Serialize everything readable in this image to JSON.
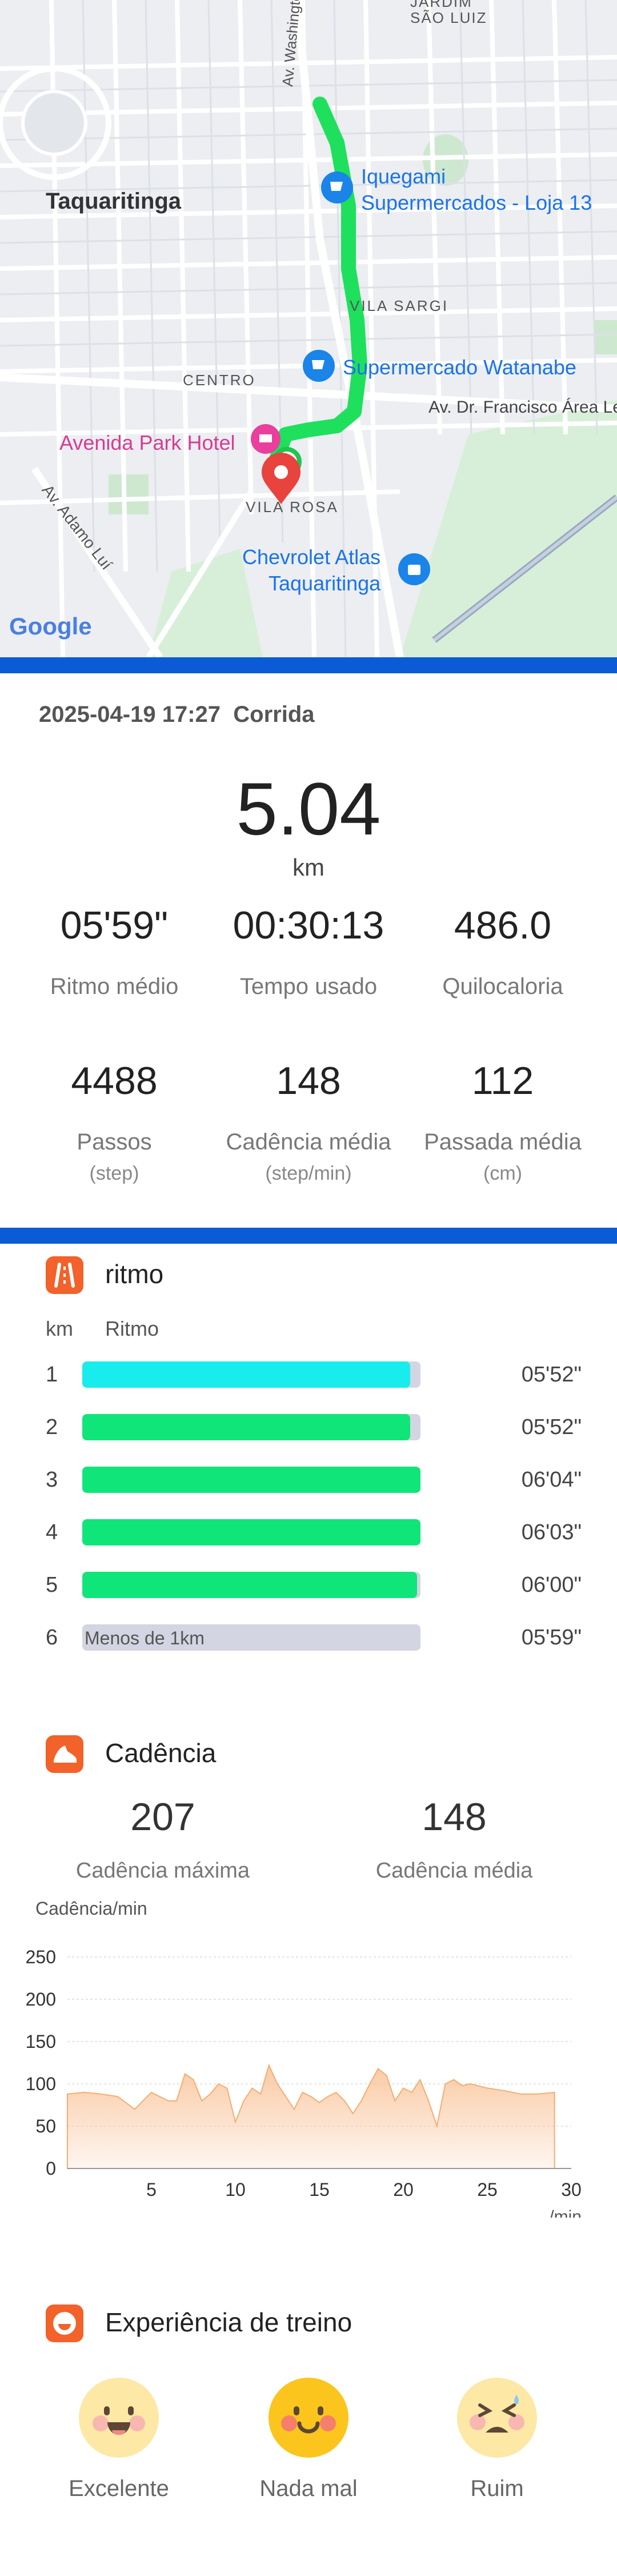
{
  "map": {
    "labels": {
      "jardim": "JARDIM",
      "sao_luiz": "SÃO LUIZ",
      "av_washington": "Av. Washington",
      "taquaritinga": "Taquaritinga",
      "iquegami_1": "Iquegami",
      "iquegami_2": "Supermercados - Loja 13",
      "vila_sargi": "VILA SARGI",
      "centro": "CENTRO",
      "watanabe": "Supermercado Watanabe",
      "av_francisco": "Av. Dr. Francisco Área Le",
      "avenida_park": "Avenida Park Hotel",
      "vila_rosa": "VILA ROSA",
      "av_adamo": "Av. Adamo Luí",
      "chevrolet_1": "Chevrolet Atlas",
      "chevrolet_2": "Taquaritinga",
      "google": "Google"
    },
    "route_color": "#1ee05d"
  },
  "summary": {
    "datetime": "2025-04-19 17:27",
    "activity": "Corrida",
    "distance": "5.04",
    "distance_unit": "km",
    "stats_row1": [
      {
        "value": "05'59\"",
        "label": "Ritmo médio"
      },
      {
        "value": "00:30:13",
        "label": "Tempo usado"
      },
      {
        "value": "486.0",
        "label": "Quilocaloria"
      }
    ],
    "stats_row2": [
      {
        "value": "4488",
        "label": "Passos",
        "unit": "(step)"
      },
      {
        "value": "148",
        "label": "Cadência média",
        "unit": "(step/min)"
      },
      {
        "value": "112",
        "label": "Passada média",
        "unit": "(cm)"
      }
    ]
  },
  "pace": {
    "title": "ritmo",
    "col_km": "km",
    "col_pace": "Ritmo",
    "rows": [
      {
        "km": "1",
        "fill": 0.97,
        "color": "#19ecec",
        "time": "05'52\""
      },
      {
        "km": "2",
        "fill": 0.97,
        "color": "#10e57a",
        "time": "05'52\""
      },
      {
        "km": "3",
        "fill": 1.0,
        "color": "#10e57a",
        "time": "06'04\""
      },
      {
        "km": "4",
        "fill": 1.0,
        "color": "#10e57a",
        "time": "06'03\""
      },
      {
        "km": "5",
        "fill": 0.99,
        "color": "#10e57a",
        "time": "06'00\""
      },
      {
        "km": "6",
        "fill": 0,
        "color": "#d3d5e2",
        "time": "05'59\"",
        "note": "Menos de 1km"
      }
    ]
  },
  "cadence": {
    "title": "Cadência",
    "max_value": "207",
    "max_label": "Cadência máxima",
    "avg_value": "148",
    "avg_label": "Cadência média"
  },
  "chart_data": {
    "type": "area",
    "ylabel": "Cadência/min",
    "xlabel": "/min",
    "ylim": [
      0,
      250
    ],
    "yticks": [
      0,
      50,
      100,
      150,
      200,
      250
    ],
    "xlim": [
      0,
      30
    ],
    "xticks": [
      5,
      10,
      15,
      20,
      25,
      30
    ],
    "grid": true,
    "fill_color": "#f9c49a",
    "x": [
      0,
      1,
      2,
      3,
      4,
      5,
      6,
      6.5,
      7,
      7.5,
      8,
      8.5,
      9,
      9.5,
      10,
      10.5,
      11,
      11.5,
      12,
      12.5,
      13,
      13.5,
      14,
      14.5,
      15,
      15.5,
      16,
      16.5,
      17,
      17.5,
      18,
      18.5,
      19,
      19.5,
      20,
      20.5,
      21,
      21.5,
      22,
      22.5,
      23,
      23.5,
      24,
      25,
      26,
      27,
      28,
      29
    ],
    "y": [
      88,
      90,
      88,
      85,
      70,
      90,
      80,
      80,
      112,
      105,
      80,
      88,
      100,
      95,
      55,
      80,
      95,
      88,
      122,
      100,
      85,
      70,
      90,
      85,
      78,
      85,
      90,
      80,
      65,
      80,
      100,
      118,
      110,
      80,
      95,
      90,
      105,
      80,
      50,
      100,
      105,
      98,
      100,
      95,
      92,
      88,
      88,
      90
    ]
  },
  "experience": {
    "title": "Experiência de treino",
    "options": [
      {
        "label": "Excelente"
      },
      {
        "label": "Nada mal"
      },
      {
        "label": "Ruim"
      }
    ]
  }
}
